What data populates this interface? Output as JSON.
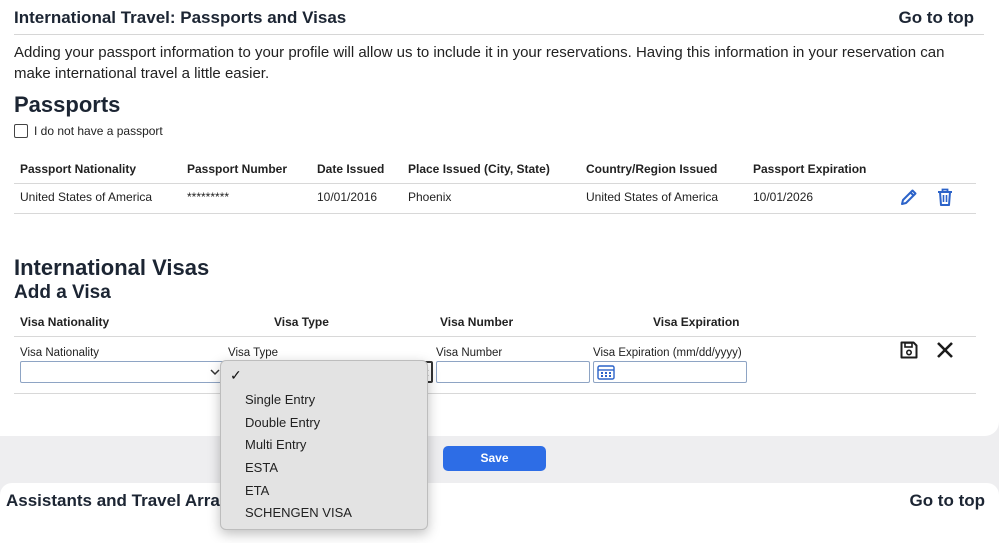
{
  "section": {
    "title": "International Travel: Passports and Visas",
    "goto_top": "Go to top",
    "intro": "Adding your passport information to your profile will allow us to include it in your reservations. Having this information in your reservation can make international travel a little easier."
  },
  "passports": {
    "heading": "Passports",
    "no_passport_label": "I do not have a passport",
    "columns": [
      "Passport Nationality",
      "Passport Number",
      "Date Issued",
      "Place Issued (City, State)",
      "Country/Region Issued",
      "Passport Expiration"
    ],
    "row": {
      "nationality": "United States of America",
      "number": "*********",
      "date_issued": "10/01/2016",
      "place_issued": "Phoenix",
      "country_issued": "United States of America",
      "expiration": "10/01/2026"
    }
  },
  "visas": {
    "heading": "International Visas",
    "subheading": "Add a Visa",
    "columns": [
      "Visa Nationality",
      "Visa Type",
      "Visa Number",
      "Visa Expiration"
    ],
    "form": {
      "nationality_label": "Visa Nationality",
      "type_label": "Visa Type",
      "number_label": "Visa Number",
      "expiration_label": "Visa Expiration (mm/dd/yyyy)"
    },
    "type_options": [
      "Single Entry",
      "Double Entry",
      "Multi Entry",
      "ESTA",
      "ETA",
      "SCHENGEN VISA"
    ],
    "save_label": "Save"
  },
  "next_section": {
    "title": "Assistants and Travel Arra",
    "goto_top": "Go to top"
  },
  "colors": {
    "accent": "#2d6de6",
    "heading": "#1c2533",
    "icon_blue": "#2c63c9"
  }
}
